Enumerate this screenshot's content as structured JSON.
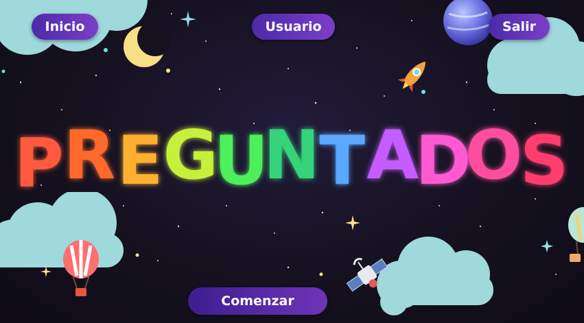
{
  "nav": {
    "inicio": "Inicio",
    "usuario": "Usuario",
    "salir": "Salir"
  },
  "title": {
    "letters": [
      {
        "char": "P",
        "color": "#ff5a3c"
      },
      {
        "char": "R",
        "color": "#ff6a2a"
      },
      {
        "char": "E",
        "color": "#ffb02e"
      },
      {
        "char": "G",
        "color": "#c8f03a"
      },
      {
        "char": "U",
        "color": "#4ef05a"
      },
      {
        "char": "N",
        "color": "#34d37a"
      },
      {
        "char": "T",
        "color": "#5aa8ff"
      },
      {
        "char": "A",
        "color": "#c45cff"
      },
      {
        "char": "D",
        "color": "#ff5ad2"
      },
      {
        "char": "O",
        "color": "#ff4ea0"
      },
      {
        "char": "S",
        "color": "#ff3c6e"
      }
    ]
  },
  "cta": {
    "comenzar": "Comenzar"
  },
  "colors": {
    "button_gradient_start": "#4b2aa8",
    "button_gradient_end": "#7b3fc7",
    "cloud": "#9fd9dc",
    "moon": "#f7df86",
    "background": "#15111f"
  },
  "icons": [
    "moon-icon",
    "planet-icon",
    "rocket-icon",
    "hot-air-balloon-icon",
    "satellite-icon",
    "sparkle-icon",
    "cloud-icon"
  ]
}
